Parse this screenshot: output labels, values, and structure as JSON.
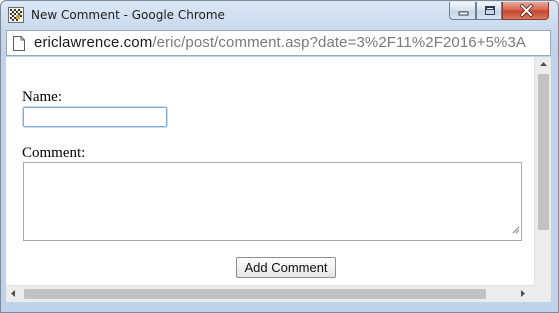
{
  "window": {
    "title": "New Comment - Google Chrome",
    "controls": {
      "minimize": "minimize",
      "maximize": "maximize",
      "close": "close"
    }
  },
  "address_bar": {
    "host": "ericlawrence.com",
    "path": "/eric/post/comment.asp?date=3%2F11%2F2016+5%3A"
  },
  "form": {
    "name_label": "Name:",
    "name_value": "",
    "comment_label": "Comment:",
    "comment_value": "",
    "submit_label": "Add Comment"
  },
  "icons": {
    "app": "chrome-app-icon",
    "page": "page-icon",
    "minimize": "minimize-icon",
    "maximize": "maximize-icon",
    "close": "close-icon",
    "resize_grip": "resize-grip-icon"
  },
  "colors": {
    "title_bar": "#c9daee",
    "close_button": "#c5442b",
    "input_focus_border": "#7eaad6",
    "scrollbar_thumb": "#c2c2c2"
  }
}
